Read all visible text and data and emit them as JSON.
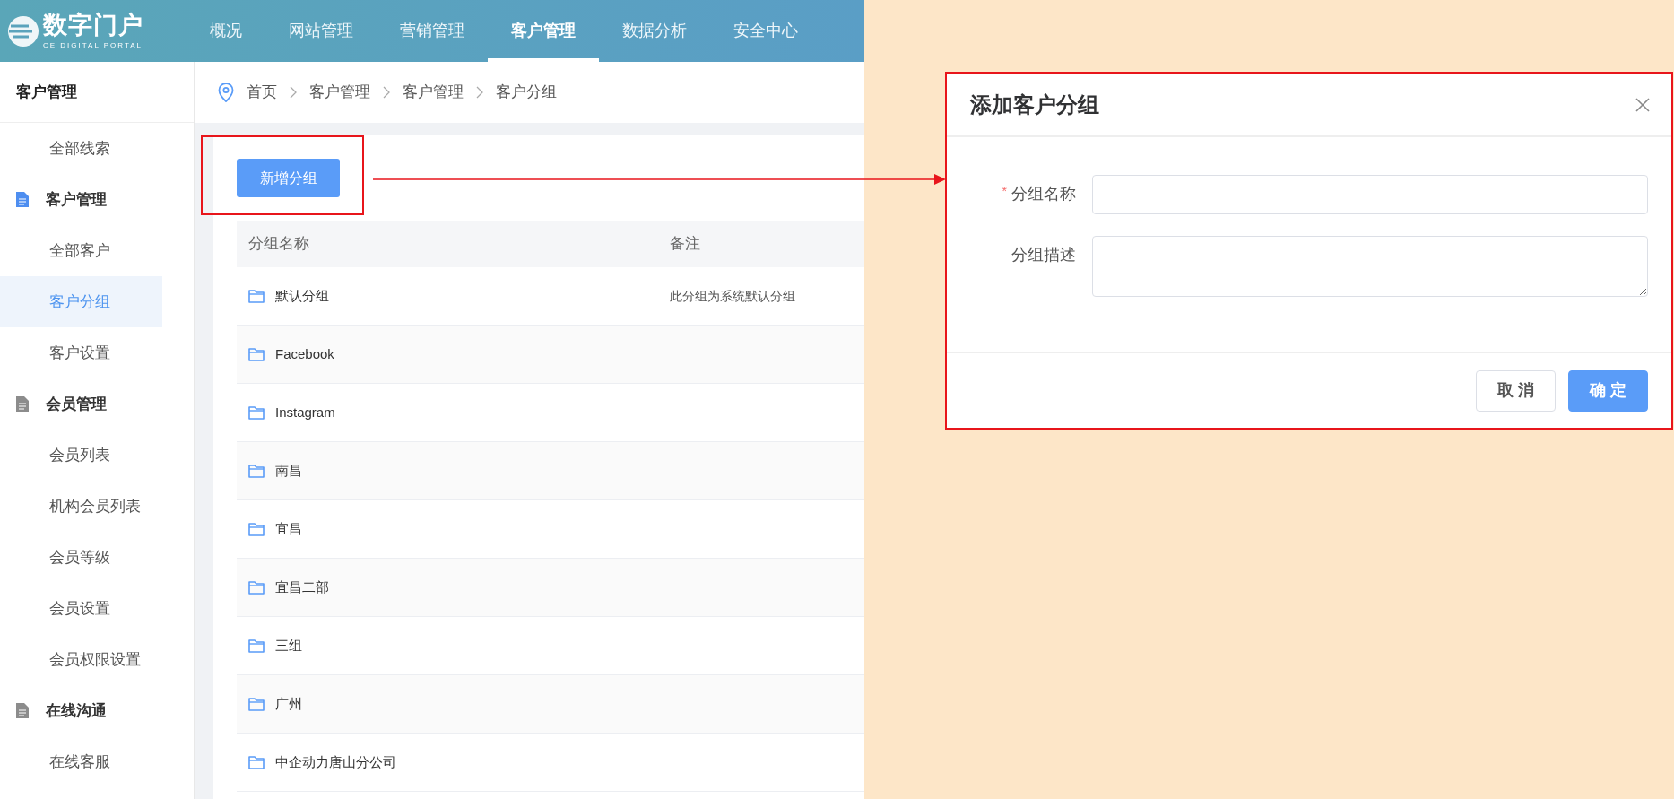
{
  "logo": {
    "title": "数字门户",
    "subtitle": "CE DIGITAL PORTAL"
  },
  "nav": [
    {
      "label": "概况",
      "selected": false
    },
    {
      "label": "网站管理",
      "selected": false
    },
    {
      "label": "营销管理",
      "selected": false
    },
    {
      "label": "客户管理",
      "selected": true
    },
    {
      "label": "数据分析",
      "selected": false
    },
    {
      "label": "安全中心",
      "selected": false
    }
  ],
  "sidebar": {
    "title": "客户管理",
    "items": [
      {
        "kind": "item",
        "label": "全部线索",
        "selected": false
      },
      {
        "kind": "group",
        "label": "客户管理",
        "active": true,
        "children": [
          {
            "label": "全部客户",
            "selected": false
          },
          {
            "label": "客户分组",
            "selected": true
          },
          {
            "label": "客户设置",
            "selected": false
          }
        ]
      },
      {
        "kind": "group",
        "label": "会员管理",
        "active": false,
        "children": [
          {
            "label": "会员列表",
            "selected": false
          },
          {
            "label": "机构会员列表",
            "selected": false
          },
          {
            "label": "会员等级",
            "selected": false
          },
          {
            "label": "会员设置",
            "selected": false
          },
          {
            "label": "会员权限设置",
            "selected": false
          }
        ]
      },
      {
        "kind": "group",
        "label": "在线沟通",
        "active": false,
        "children": [
          {
            "label": "在线客服",
            "selected": false
          }
        ]
      }
    ]
  },
  "breadcrumb": [
    "首页",
    "客户管理",
    "客户管理",
    "客户分组"
  ],
  "add_button": "新增分组",
  "table": {
    "columns": [
      "分组名称",
      "备注"
    ],
    "rows": [
      {
        "name": "默认分组",
        "note": "此分组为系统默认分组"
      },
      {
        "name": "Facebook"
      },
      {
        "name": "Instagram"
      },
      {
        "name": "南昌"
      },
      {
        "name": "宜昌"
      },
      {
        "name": "宜昌二部"
      },
      {
        "name": "三组"
      },
      {
        "name": "广州"
      },
      {
        "name": "中企动力唐山分公司"
      }
    ]
  },
  "dialog": {
    "title": "添加客户分组",
    "fields": [
      {
        "kind": "input",
        "label": "分组名称",
        "required_mark": "*"
      },
      {
        "kind": "textarea",
        "label": "分组描述"
      }
    ],
    "buttons": [
      {
        "label": "取 消",
        "primary": false
      },
      {
        "label": "确 定",
        "primary": true
      }
    ]
  }
}
